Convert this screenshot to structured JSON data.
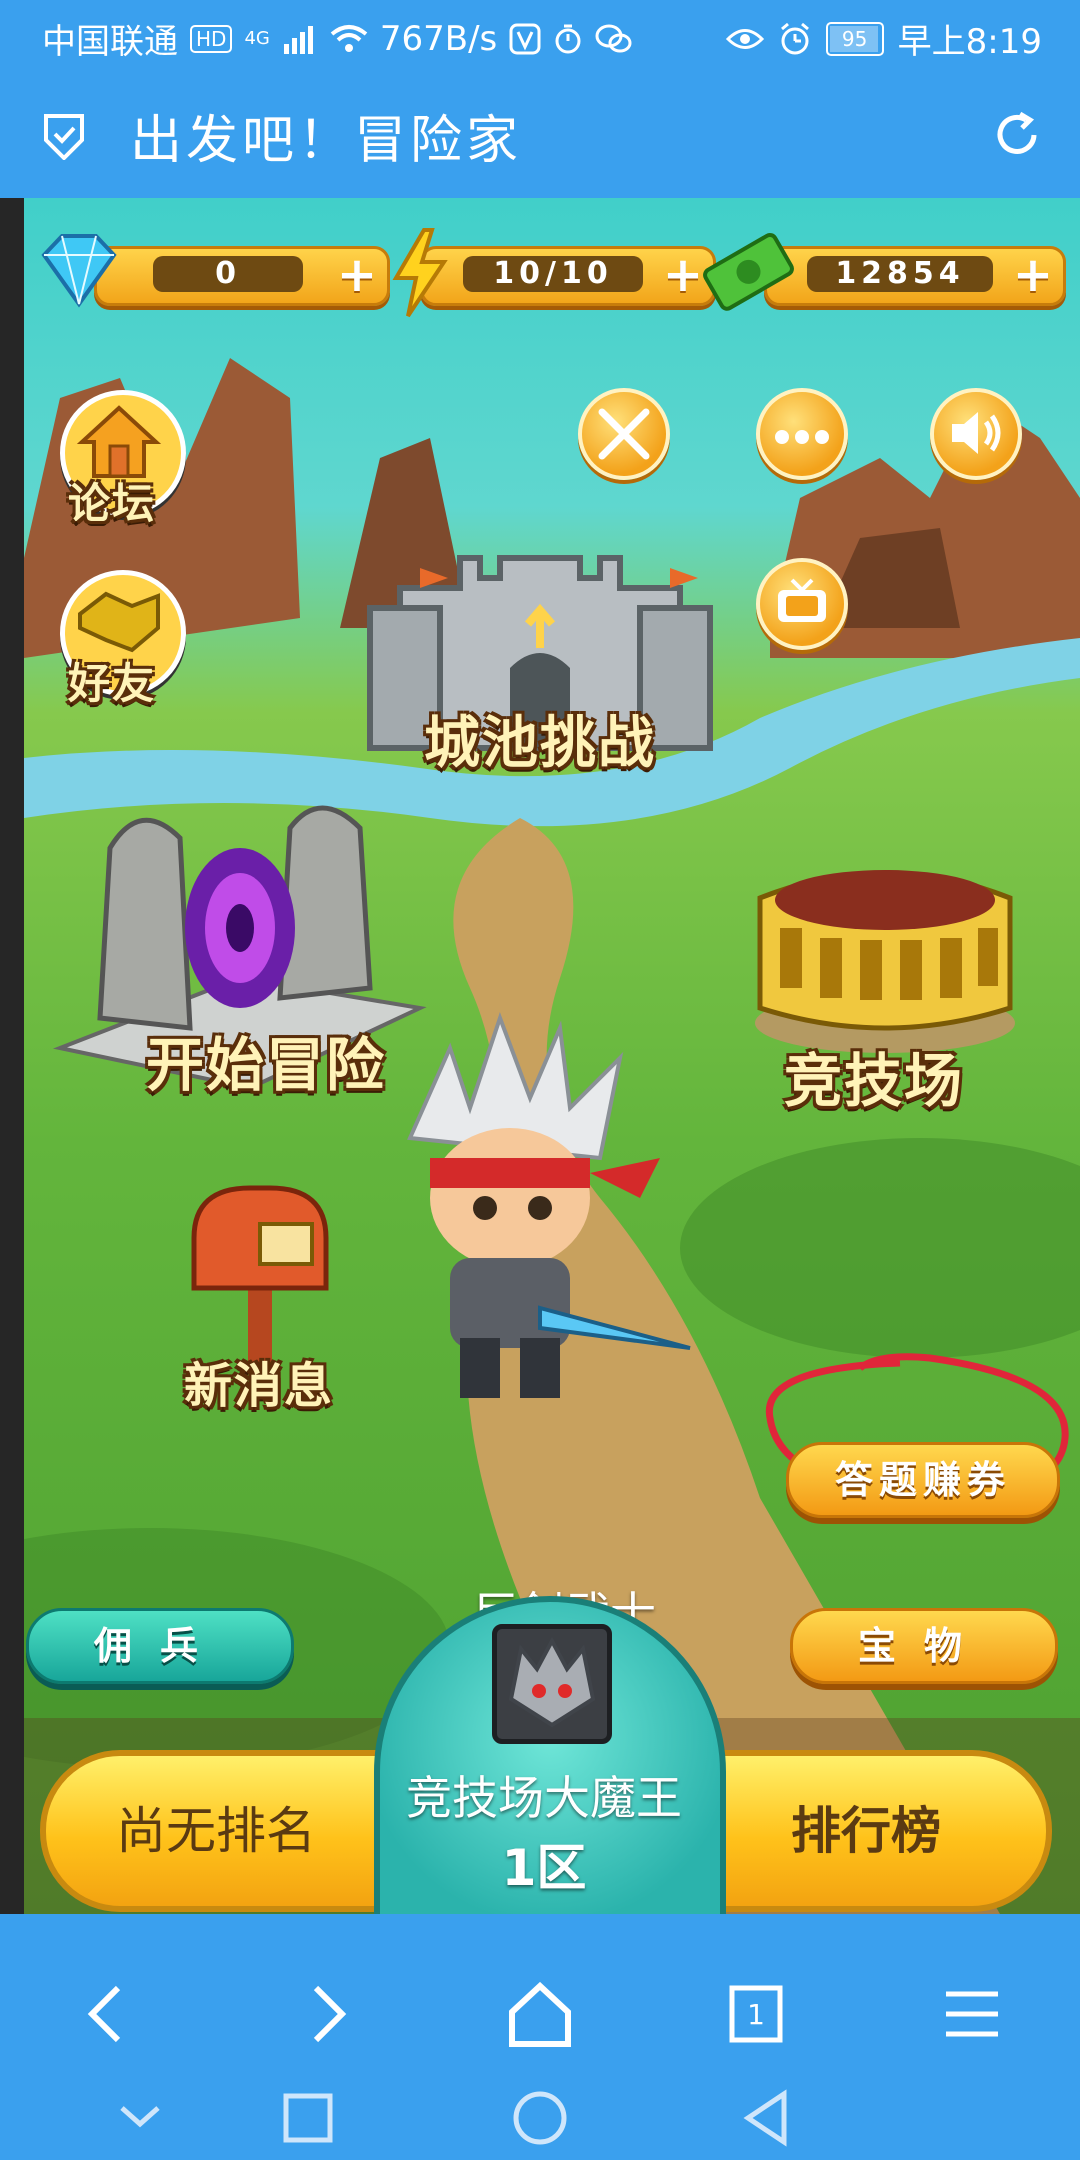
{
  "status_bar": {
    "carrier": "中国联通",
    "hd": "HD",
    "net": "4G",
    "speed": "767B/s",
    "battery": "95",
    "time": "早上8:19"
  },
  "app_bar": {
    "title": "出发吧！冒险家"
  },
  "game": {
    "resources": [
      {
        "icon": "gem-icon",
        "value": "0"
      },
      {
        "icon": "lightning-icon",
        "value": "10/10"
      },
      {
        "icon": "cash-icon",
        "value": "12854"
      }
    ],
    "side_buttons": {
      "forum": "论坛",
      "friends": "好友"
    },
    "locations": {
      "castle": "城池挑战",
      "adventure": "开始冒险",
      "arena": "竞技场",
      "mail": "新消息"
    },
    "hero_name": "巨剑武士",
    "quiz_button": "答题赚券",
    "mercenary_button": "佣兵",
    "treasure_button": "宝物",
    "bottom": {
      "rank_label": "尚无排名",
      "boss_title": "竞技场大魔王",
      "zone": "1区",
      "leaderboard": "排行榜"
    },
    "colors": {
      "accent_blue": "#3aa0ee",
      "gold": "#f3a21a",
      "teal": "#18a69a",
      "circle_annotation": "#e0263a"
    }
  }
}
